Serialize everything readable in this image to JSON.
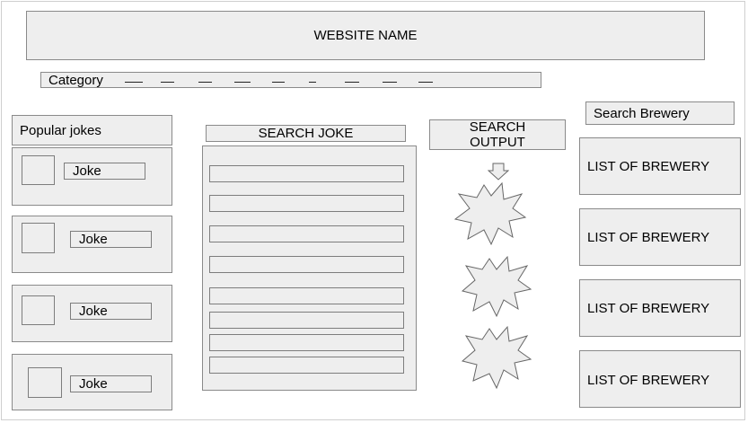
{
  "header": {
    "title": "WEBSITE NAME"
  },
  "category_bar": {
    "label": "Category",
    "dash_count": 9
  },
  "popular_jokes": {
    "heading": "Popular jokes",
    "items": [
      {
        "label": "Joke"
      },
      {
        "label": "Joke"
      },
      {
        "label": "Joke"
      },
      {
        "label": "Joke"
      }
    ]
  },
  "search_joke": {
    "label": "SEARCH JOKE",
    "result_rows": 8
  },
  "search_output": {
    "label": "SEARCH OUTPUT",
    "arrow_icon": "down-arrow-icon",
    "burst_icon": "starburst-icon",
    "burst_count": 3
  },
  "brewery": {
    "search_label": "Search Brewery",
    "lists": [
      {
        "label": "LIST OF BREWERY"
      },
      {
        "label": "LIST OF BREWERY"
      },
      {
        "label": "LIST OF BREWERY"
      },
      {
        "label": "LIST OF BREWERY"
      }
    ]
  },
  "colors": {
    "fill": "#eeeeee",
    "stroke": "#8a8a8a",
    "text": "#000000"
  }
}
